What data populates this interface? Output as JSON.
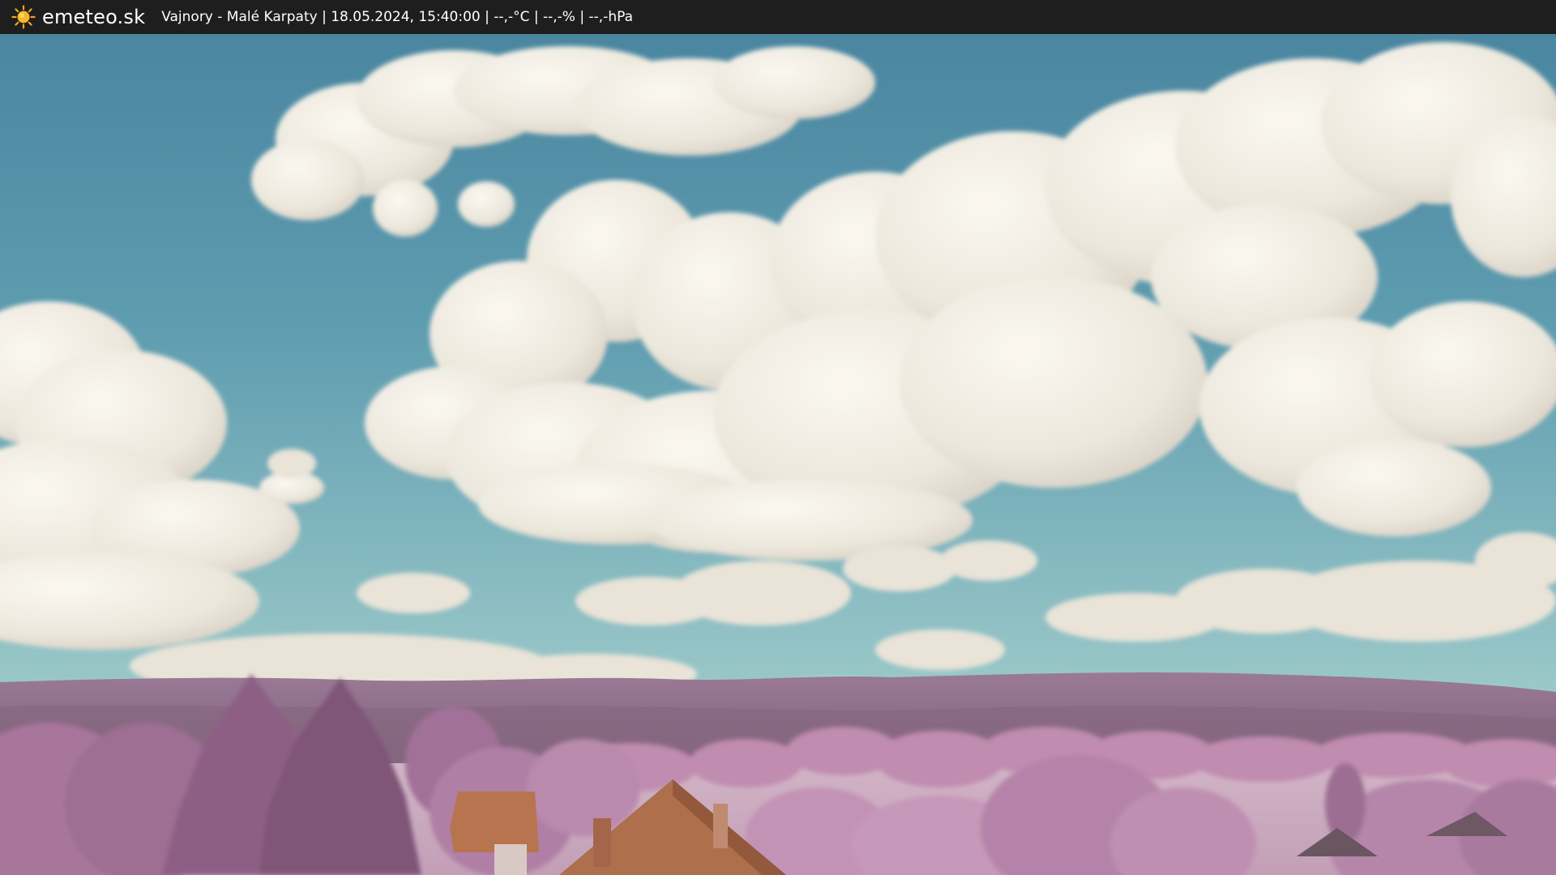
{
  "header": {
    "brand": "emeteo.sk",
    "location": "Vajnory - Malé Karpaty",
    "datetime": "18.05.2024, 15:40:00",
    "temperature": "--,-°C",
    "humidity": "--,-%",
    "pressure": "--,-hPa",
    "separator": " | ",
    "logo_icon": "sun-icon"
  },
  "webcam": {
    "scene": "infrared-landscape",
    "colors": {
      "sky_top": "#4d8aa3",
      "sky_horizon": "#8ec4c8",
      "cloud": "#eeeae2",
      "hills": "#8a6a86",
      "foliage": "#b37fa4",
      "field": "#c8a8bd",
      "roof": "#b5734f"
    }
  }
}
